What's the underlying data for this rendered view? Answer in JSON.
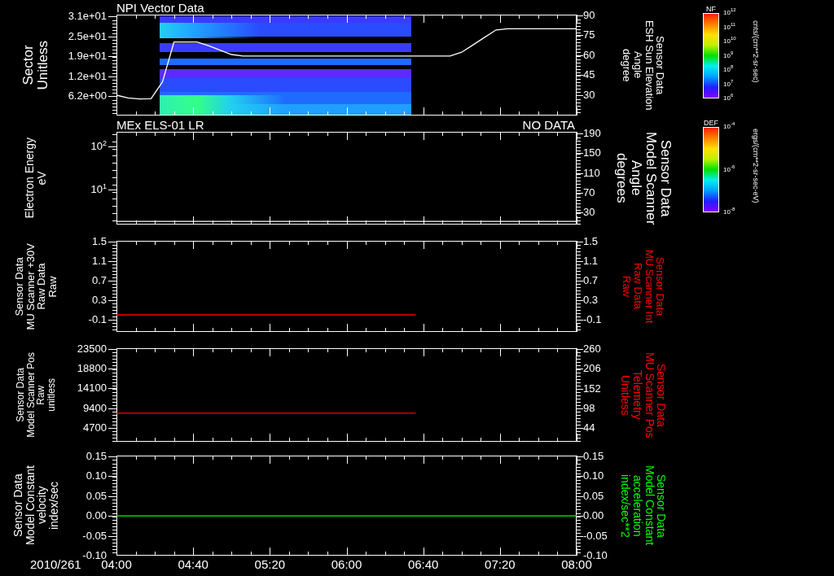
{
  "panels": [
    {
      "title": "NPI Vector Data",
      "left_axis": {
        "label": [
          "Sector",
          "Unitless"
        ],
        "color": "#ffffff",
        "ticks": [
          "3.1e+01",
          "2.5e+01",
          "1.9e+01",
          "1.2e+01",
          "6.2e+00"
        ]
      },
      "right_axis": {
        "label": [
          "Sensor Data",
          "ESH Sun Elevation",
          "Angle",
          "degree"
        ],
        "color": "#ffffff"
      },
      "plot": {
        "kind": "spectrogram",
        "chart_data": {
          "type": "line",
          "ylim": [
            14.7,
            90.6
          ],
          "yticks": [
            {
              "value": 90,
              "label": "90"
            },
            {
              "value": 75,
              "label": "75"
            },
            {
              "value": 60,
              "label": "60"
            },
            {
              "value": 45,
              "label": "45"
            },
            {
              "value": 30,
              "label": "30"
            }
          ],
          "categories": [
            null,
            null,
            null,
            null,
            null,
            null,
            null,
            null,
            null,
            null,
            null,
            null,
            null,
            null,
            null,
            null,
            null,
            null,
            null,
            null,
            null,
            null,
            null,
            null,
            null,
            null,
            null,
            null,
            null,
            null,
            null,
            null,
            null,
            null,
            null,
            null,
            null,
            null,
            null,
            null,
            null
          ],
          "series": [
            {
              "color": "#ffffff",
              "values": [
                30,
                27.9,
                27.2,
                27.4,
                40,
                70,
                70,
                70,
                67.2,
                63.9,
                60.6,
                59.5,
                59.5,
                59.5,
                59.5,
                59.5,
                59.5,
                59.5,
                59.5,
                59.5,
                59.5,
                59.5,
                59.5,
                59.5,
                59.5,
                59.5,
                59.5,
                59.5,
                59.5,
                59.5,
                62.3,
                67.9,
                73.5,
                79.1,
                80,
                80,
                80,
                80,
                80,
                80,
                80
              ]
            }
          ]
        }
      }
    },
    {
      "title": "MEx ELS-01 LR",
      "status": "NO DATA",
      "left_axis": {
        "label": [
          "Electron Energy",
          "eV"
        ],
        "color": "#ffffff",
        "ticks": [
          "10$^{2}$",
          "10$^{1}$"
        ]
      },
      "right_axis": {
        "label": [
          "Sensor Data",
          "Model Scanner",
          "Angle",
          "degrees"
        ],
        "color": "#ffffff"
      },
      "plot": {
        "kind": "line",
        "chart_data": {
          "type": "line",
          "ylim": [
            5.5,
            193.3
          ],
          "yticks": [
            {
              "value": 190,
              "label": "190"
            },
            {
              "value": 150,
              "label": "150"
            },
            {
              "value": 110,
              "label": "110"
            },
            {
              "value": 70,
              "label": "70"
            },
            {
              "value": 30,
              "label": "30"
            }
          ],
          "categories": [
            null,
            null,
            null,
            null,
            null,
            null,
            null,
            null,
            null,
            null,
            null,
            null,
            null,
            null,
            null,
            null,
            null,
            null,
            null,
            null,
            null,
            null,
            null,
            null,
            null,
            null,
            null,
            null,
            null,
            null,
            null,
            null,
            null,
            null,
            null,
            null,
            null,
            null,
            null,
            null,
            null
          ],
          "series": [
            {
              "color": "#ffffff",
              "values": [
                12,
                12,
                12,
                12,
                12,
                12,
                12,
                12,
                12,
                12,
                12,
                12,
                12,
                12,
                12,
                12,
                12,
                12,
                12,
                12,
                12,
                12,
                12,
                12,
                12,
                12,
                12,
                12,
                12,
                12,
                12,
                12,
                12,
                12,
                12,
                12,
                12,
                12,
                12,
                12,
                12
              ]
            }
          ]
        }
      }
    },
    {
      "left_axis": {
        "label": [
          "Sensor Data",
          "MU Scanner +30V",
          "Raw Data",
          "Raw"
        ],
        "color": "#ffffff"
      },
      "right_axis": {
        "label": [
          "Sensor Data",
          "MU Scanner Int",
          "Raw Data",
          "Raw"
        ],
        "color": "#ff0000",
        "ticks": [
          "1.5",
          "1.1",
          "0.7",
          "0.3",
          "-0.1"
        ]
      },
      "plot": {
        "kind": "line",
        "chart_data": {
          "type": "line",
          "ylim": [
            -0.35,
            1.52
          ],
          "yticks": [
            {
              "value": 1.5,
              "label": "1.5"
            },
            {
              "value": 1.1,
              "label": "1.1"
            },
            {
              "value": 0.7,
              "label": "0.7"
            },
            {
              "value": 0.3,
              "label": "0.3"
            },
            {
              "value": -0.1,
              "label": "-0.1"
            }
          ],
          "categories": [
            null,
            null,
            null,
            null,
            null,
            null,
            null,
            null,
            null,
            null,
            null,
            null,
            null,
            null,
            null,
            null,
            null,
            null,
            null,
            null,
            null,
            null,
            null,
            null,
            null,
            null,
            null,
            null,
            null,
            null,
            null,
            null,
            null,
            null,
            null,
            null,
            null,
            null,
            null,
            null,
            null
          ],
          "series": [
            {
              "color": "#ff0000",
              "values": [
                0,
                0,
                0,
                0,
                0,
                0,
                0,
                0,
                0,
                0,
                0,
                0,
                0,
                0,
                0,
                0,
                0,
                0,
                0,
                0,
                0,
                0,
                0,
                0,
                0,
                0,
                0,
                null,
                null,
                null,
                null,
                null,
                null,
                null,
                null,
                null,
                null,
                null,
                null,
                null,
                null
              ]
            }
          ]
        }
      }
    },
    {
      "left_axis": {
        "label": [
          "Sensor Data",
          "Model Scanner Pos",
          "Raw",
          "unitless"
        ],
        "color": "#ffffff"
      },
      "right_axis": {
        "label": [
          "Sensor Data",
          "MU Scanner Pos",
          "Telemetry",
          "Unitless"
        ],
        "color": "#ff0000",
        "ticks": [
          "260",
          "206",
          "152",
          "98",
          "44"
        ]
      },
      "plot": {
        "kind": "line",
        "chart_data": {
          "type": "line",
          "ylim": [
            1400,
            23694
          ],
          "yticks": [
            {
              "value": 23500,
              "label": "23500"
            },
            {
              "value": 18800,
              "label": "18800"
            },
            {
              "value": 14100,
              "label": "14100"
            },
            {
              "value": 9400,
              "label": "9400"
            },
            {
              "value": 4700,
              "label": "4700"
            }
          ],
          "categories": [
            null,
            null,
            null,
            null,
            null,
            null,
            null,
            null,
            null,
            null,
            null,
            null,
            null,
            null,
            null,
            null,
            null,
            null,
            null,
            null,
            null,
            null,
            null,
            null,
            null,
            null,
            null,
            null,
            null,
            null,
            null,
            null,
            null,
            null,
            null,
            null,
            null,
            null,
            null,
            null,
            null
          ],
          "series": [
            {
              "color": "#ff0000",
              "values": [
                8200,
                8200,
                8200,
                8200,
                8200,
                8200,
                8200,
                8200,
                8200,
                8200,
                8200,
                8200,
                8200,
                8200,
                8200,
                8200,
                8200,
                8200,
                8200,
                8200,
                8200,
                8200,
                8200,
                8200,
                8200,
                8200,
                8200,
                null,
                null,
                null,
                null,
                null,
                null,
                null,
                null,
                null,
                null,
                null,
                null,
                null,
                null
              ]
            }
          ]
        }
      }
    },
    {
      "left_axis": {
        "label": [
          "Sensor Data",
          "Model Constant",
          "velocity",
          "index/sec"
        ],
        "color": "#ffffff"
      },
      "right_axis": {
        "label": [
          "Sensor Data",
          "Model Constant",
          "acceleration",
          "index/sec**2"
        ],
        "color": "#00ff00",
        "ticks": [
          "0.15",
          "0.10",
          "0.05",
          "0.00",
          "-0.05",
          "-0.10"
        ]
      },
      "plot": {
        "kind": "line",
        "chart_data": {
          "type": "line",
          "xlim": [
            4,
            8
          ],
          "ylim": [
            -0.1,
            0.152
          ],
          "yticks": [
            {
              "value": 0.15,
              "label": "0.15"
            },
            {
              "value": 0.1,
              "label": "0.10"
            },
            {
              "value": 0.05,
              "label": "0.05"
            },
            {
              "value": 0,
              "label": "0.00"
            },
            {
              "value": -0.05,
              "label": "-0.05"
            },
            {
              "value": -0.1,
              "label": "-0.10"
            }
          ],
          "xticks": [
            {
              "value": 4,
              "label": "04:00"
            },
            {
              "value": 4.6667,
              "label": "04:40"
            },
            {
              "value": 5.3333,
              "label": "05:20"
            },
            {
              "value": 6,
              "label": "06:00"
            },
            {
              "value": 6.6667,
              "label": "06:40"
            },
            {
              "value": 7.3333,
              "label": "07:20"
            },
            {
              "value": 8,
              "label": "08:00"
            }
          ],
          "x": [
            4,
            8
          ],
          "series": [
            {
              "color": "#00ff00",
              "values": [
                0,
                0
              ]
            }
          ]
        }
      }
    }
  ],
  "colorbars": [
    {
      "title": "NF",
      "ticks": [
        "10$^{12}$",
        "10$^{11}$",
        "10$^{10}$",
        "10$^{9}$",
        "10$^{8}$",
        "10$^{7}$",
        "10$^{6}$"
      ],
      "units": "cnts/(cm**2-sr-sec)"
    },
    {
      "title": "DEF",
      "ticks": [
        "10$^{-4}$",
        "10$^{-6}$",
        "10$^{-8}$"
      ],
      "units": "ergs/(cm**2-sr-sec-eV)"
    }
  ],
  "time_axis": {
    "date": "2010/261"
  }
}
